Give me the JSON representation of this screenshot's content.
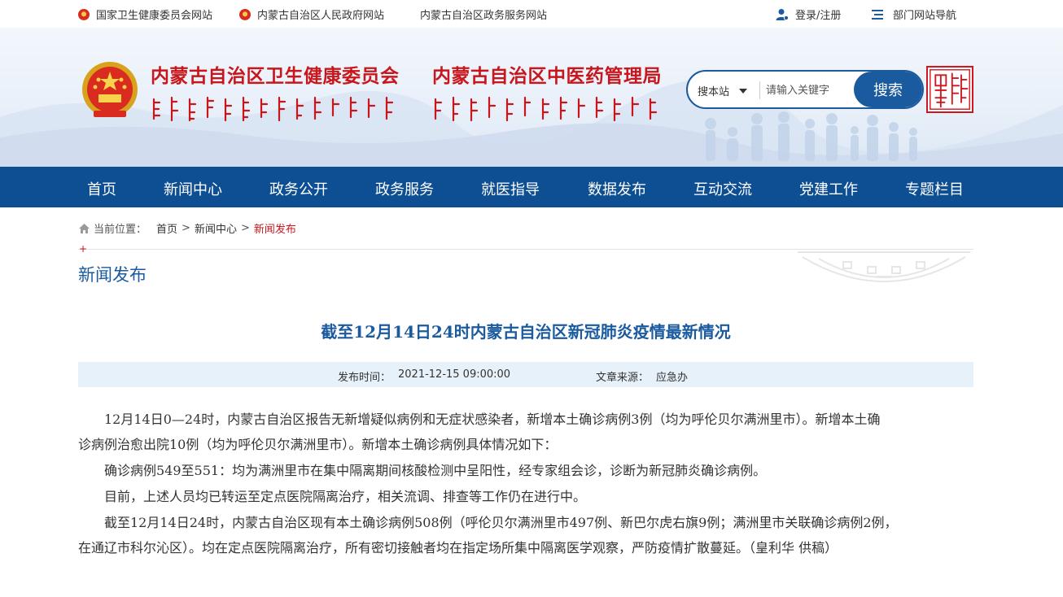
{
  "topbar": {
    "link1": "国家卫生健康委员会网站",
    "link2": "内蒙古自治区人民政府网站",
    "link3": "内蒙古自治区政务服务网站",
    "login": "登录/注册",
    "dept_nav": "部门网站导航"
  },
  "header": {
    "title_left": "内蒙古自治区卫生健康委员会",
    "title_right": "内蒙古自治区中医药管理局",
    "search_scope": "搜本站",
    "search_placeholder": "请输入关键字",
    "search_button": "搜索"
  },
  "nav": {
    "items": [
      "首页",
      "新闻中心",
      "政务公开",
      "政务服务",
      "就医指导",
      "数据发布",
      "互动交流",
      "党建工作",
      "专题栏目"
    ]
  },
  "breadcrumb": {
    "prefix": "当前位置：",
    "home": "首页",
    "level1": "新闻中心",
    "current": "新闻发布",
    "sep": ">"
  },
  "section": {
    "plus": "+",
    "title": "新闻发布"
  },
  "article": {
    "title": "截至12月14日24时内蒙古自治区新冠肺炎疫情最新情况",
    "publish_label": "发布时间：",
    "publish_time": "2021-12-15 09:00:00",
    "source_label": "文章来源：",
    "source": "应急办",
    "lines": [
      "　　12月14日0—24时，内蒙古自治区报告无新增疑似病例和无症状感染者，新增本土确诊病例3例（均为呼伦贝尔满洲里市）。新增本土确",
      "诊病例治愈出院10例（均为呼伦贝尔满洲里市）。新增本土确诊病例具体情况如下：",
      "　　确诊病例549至551：均为满洲里市在集中隔离期间核酸检测中呈阳性，经专家组会诊，诊断为新冠肺炎确诊病例。",
      "　　目前，上述人员均已转运至定点医院隔离治疗，相关流调、排查等工作仍在进行中。",
      "　　截至12月14日24时，内蒙古自治区现有本土确诊病例508例（呼伦贝尔满洲里市497例、新巴尔虎右旗9例；满洲里市关联确诊病例2例，",
      "在通辽市科尔沁区）。均在定点医院隔离治疗，所有密切接触者均在指定场所集中隔离医学观察，严防疫情扩散蔓延。（皇利华 供稿）"
    ]
  },
  "colors": {
    "brand_red": "#c8161d",
    "nav_blue": "#0e4f94",
    "title_blue": "#1a5a9e",
    "meta_bg": "#e7f1f9"
  },
  "icons": [
    "national-emblem-icon",
    "user-icon",
    "menu-list-icon",
    "home-icon",
    "dropdown-caret-icon"
  ]
}
